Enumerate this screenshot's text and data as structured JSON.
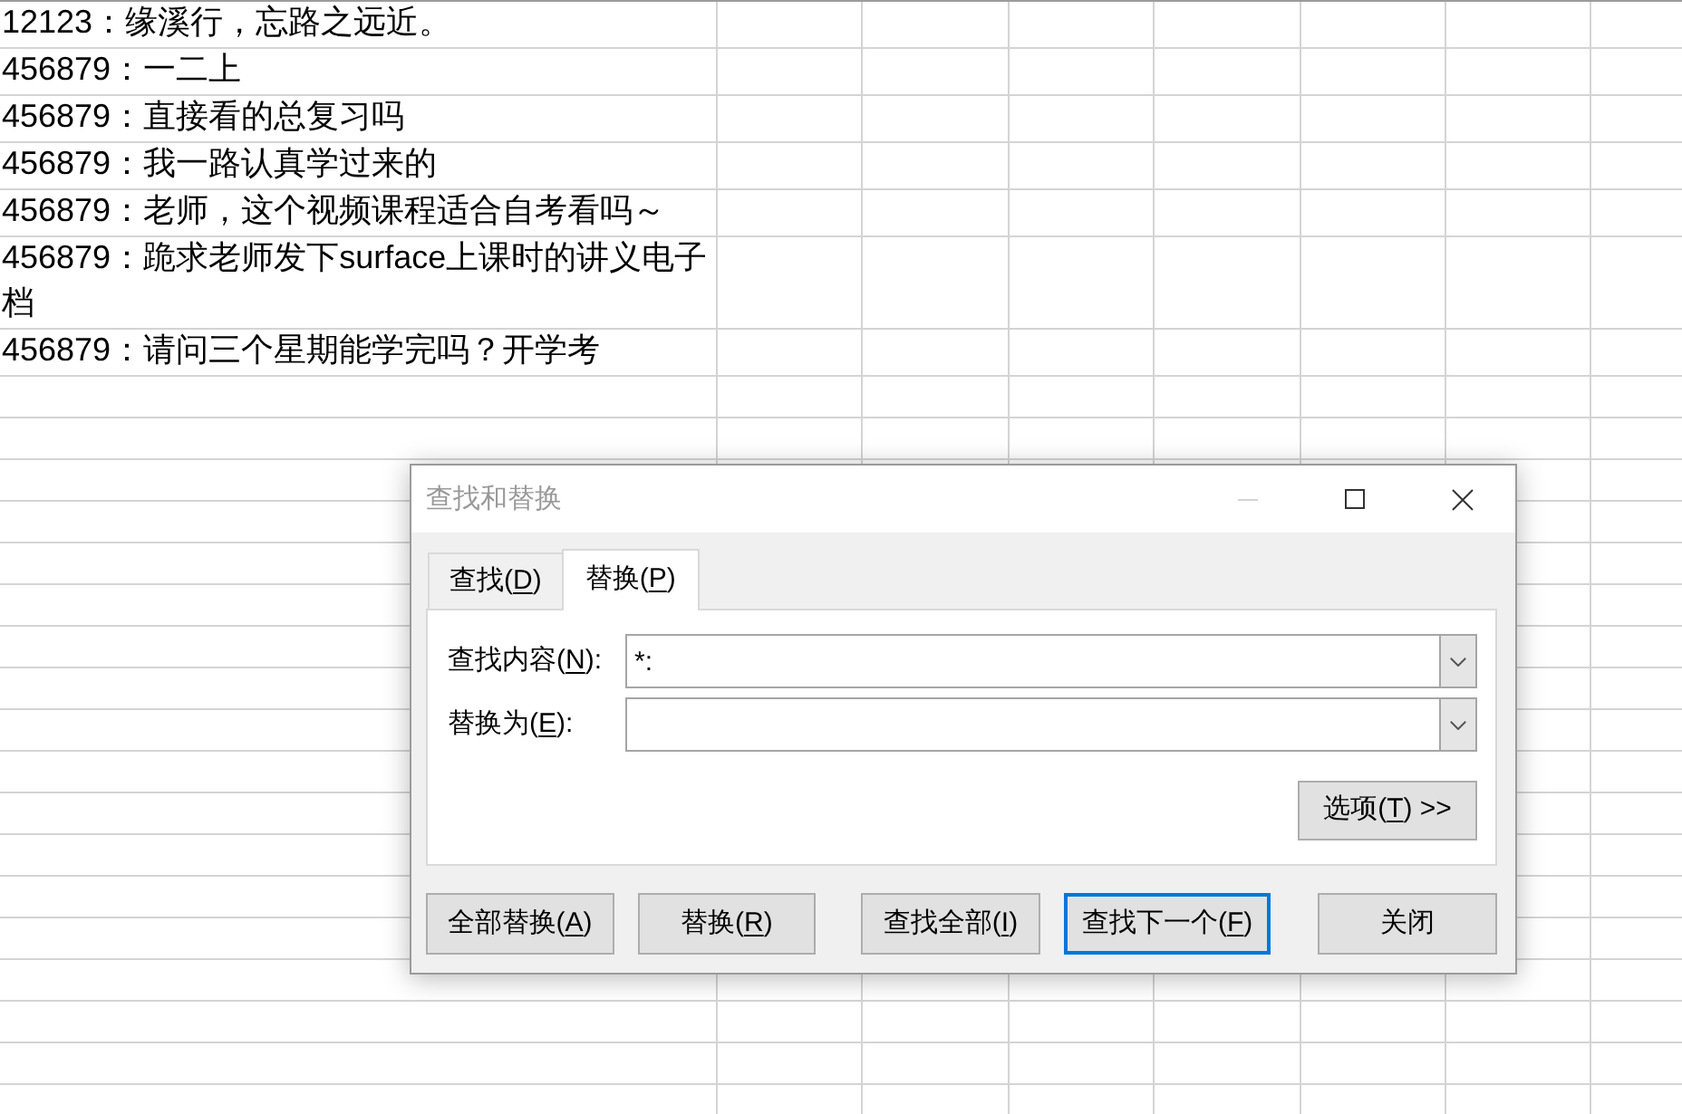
{
  "sheet": {
    "rows": [
      {
        "cells": [
          "12123：缘溪行，忘路之远近。"
        ]
      },
      {
        "cells": [
          "456879：一二上"
        ]
      },
      {
        "cells": [
          "456879：直接看的总复习吗"
        ]
      },
      {
        "cells": [
          "456879：我一路认真学过来的"
        ]
      },
      {
        "cells": [
          "456879：老师，这个视频课程适合自考看吗～"
        ]
      },
      {
        "cells": [
          "456879：跪求老师发下surface上课时的讲义电子档"
        ]
      },
      {
        "cells": [
          "456879：请问三个星期能学完吗？开学考"
        ]
      }
    ]
  },
  "dialog": {
    "title": "查找和替换",
    "active": false,
    "window_controls": [
      {
        "kind": "minimize",
        "disabled": true
      },
      {
        "kind": "maximize",
        "disabled": false
      },
      {
        "kind": "close",
        "disabled": false
      }
    ],
    "tabs": [
      {
        "label": "查找(D)",
        "access_key_underlined": true,
        "selected": false
      },
      {
        "label": "替换(P)",
        "access_key_underlined": true,
        "selected": true
      }
    ],
    "fields": [
      {
        "label": "查找内容(N):",
        "access_key_underlined": true,
        "value": "*:"
      },
      {
        "label": "替换为(E):",
        "access_key_underlined": true
      }
    ],
    "options_button": {
      "label": "选项(T) >>",
      "access_key_underlined": true
    },
    "buttons": [
      {
        "label": "全部替换(A)",
        "access_key_underlined": true,
        "default": false
      },
      {
        "label": "替换(R)",
        "access_key_underlined": true,
        "default": false
      },
      {
        "label": "查找全部(I)",
        "access_key_underlined": true,
        "default": false
      },
      {
        "label": "查找下一个(F)",
        "access_key_underlined": true,
        "default": true
      },
      {
        "label": "关闭",
        "default": false
      }
    ]
  }
}
